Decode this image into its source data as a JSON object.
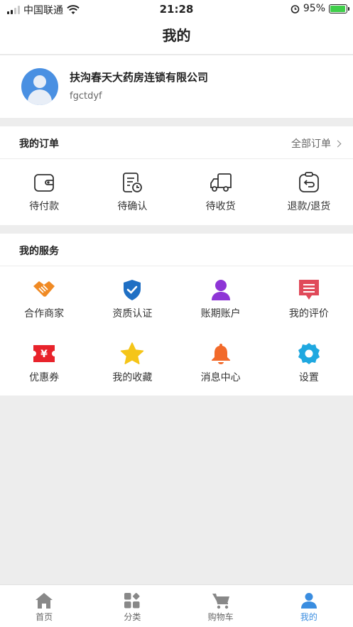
{
  "status_bar": {
    "carrier": "中国联通",
    "time": "21:28",
    "battery": "95%",
    "battery_level": 0.95
  },
  "header": {
    "title": "我的"
  },
  "profile": {
    "company": "扶沟春天大药房连锁有限公司",
    "username": "fgctdyf"
  },
  "orders": {
    "title": "我的订单",
    "all_label": "全部订单",
    "items": [
      {
        "label": "待付款",
        "icon": "wallet-icon"
      },
      {
        "label": "待确认",
        "icon": "document-clock-icon"
      },
      {
        "label": "待收货",
        "icon": "truck-icon"
      },
      {
        "label": "退款/退货",
        "icon": "return-box-icon"
      }
    ]
  },
  "services": {
    "title": "我的服务",
    "items": [
      {
        "label": "合作商家",
        "icon": "handshake-icon",
        "color": "#f08a24"
      },
      {
        "label": "资质认证",
        "icon": "shield-check-icon",
        "color": "#1f6fc4"
      },
      {
        "label": "账期账户",
        "icon": "person-icon",
        "color": "#8e35d6"
      },
      {
        "label": "我的评价",
        "icon": "comment-icon",
        "color": "#e04a5a"
      },
      {
        "label": "优惠券",
        "icon": "coupon-icon",
        "color": "#e8232b"
      },
      {
        "label": "我的收藏",
        "icon": "star-icon",
        "color": "#f5c518"
      },
      {
        "label": "消息中心",
        "icon": "bell-icon",
        "color": "#f26a2a"
      },
      {
        "label": "设置",
        "icon": "gear-icon",
        "color": "#1fa8e0"
      }
    ]
  },
  "tabbar": {
    "tabs": [
      {
        "label": "首页",
        "icon": "home-icon"
      },
      {
        "label": "分类",
        "icon": "category-icon"
      },
      {
        "label": "购物车",
        "icon": "cart-icon"
      },
      {
        "label": "我的",
        "icon": "user-icon"
      }
    ],
    "active_index": 3,
    "active_color": "#3a8de0",
    "inactive_color": "#888888"
  }
}
